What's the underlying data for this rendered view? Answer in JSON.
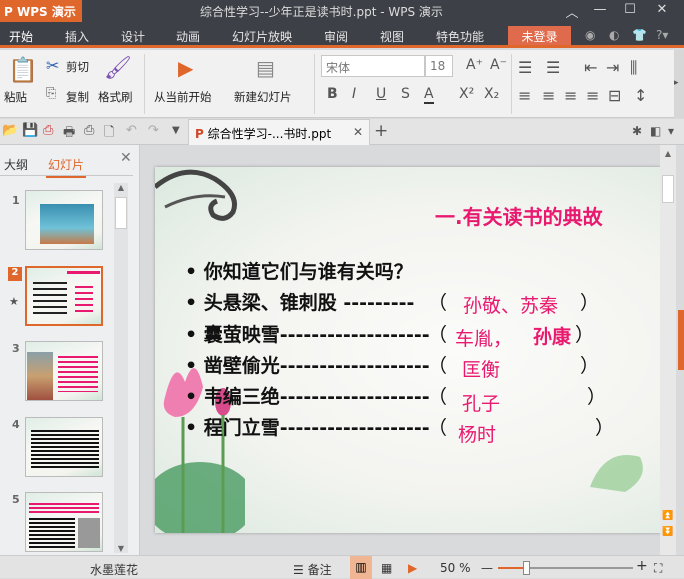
{
  "app": {
    "name": "WPS 演示",
    "title": "综合性学习--少年正是读书时.ppt - WPS 演示"
  },
  "menu": [
    "开始",
    "插入",
    "设计",
    "动画",
    "幻灯片放映",
    "审阅",
    "视图",
    "特色功能"
  ],
  "login": "未登录",
  "ribbon": {
    "paste": "粘贴",
    "cut": "剪切",
    "copy": "复制",
    "format_painter": "格式刷",
    "play_from_current": "从当前开始",
    "new_slide": "新建幻灯片",
    "font": "宋体",
    "font_size": "18"
  },
  "tab": {
    "label": "综合性学习-...书时.ppt"
  },
  "panel": {
    "tabs": [
      "大纲",
      "幻灯片"
    ],
    "slides": [
      "1",
      "2",
      "3",
      "4",
      "5"
    ],
    "selected": 2
  },
  "slide": {
    "title": "一.有关读书的典故",
    "rows": [
      {
        "text": "你知道它们与谁有关吗？",
        "answer": ""
      },
      {
        "text": "头悬梁、锥刺股 ---------",
        "answer": "孙敬、苏秦"
      },
      {
        "text": "囊萤映雪-------------------",
        "answer": "车胤，",
        "answer2": "孙康"
      },
      {
        "text": "凿壁偷光-------------------",
        "answer": "匡衡"
      },
      {
        "text": "韦编三绝-------------------",
        "answer": "孔子"
      },
      {
        "text": "程门立雪-------------------",
        "answer": "杨时"
      }
    ],
    "open_paren": "（",
    "close_paren": "）"
  },
  "status": {
    "theme": "水墨莲花",
    "notes": "备注",
    "zoom": "50 %",
    "zoom_percent": 50
  },
  "colors": {
    "accent": "#e0672b",
    "pink": "#e8196e",
    "dark": "#3d4047"
  }
}
